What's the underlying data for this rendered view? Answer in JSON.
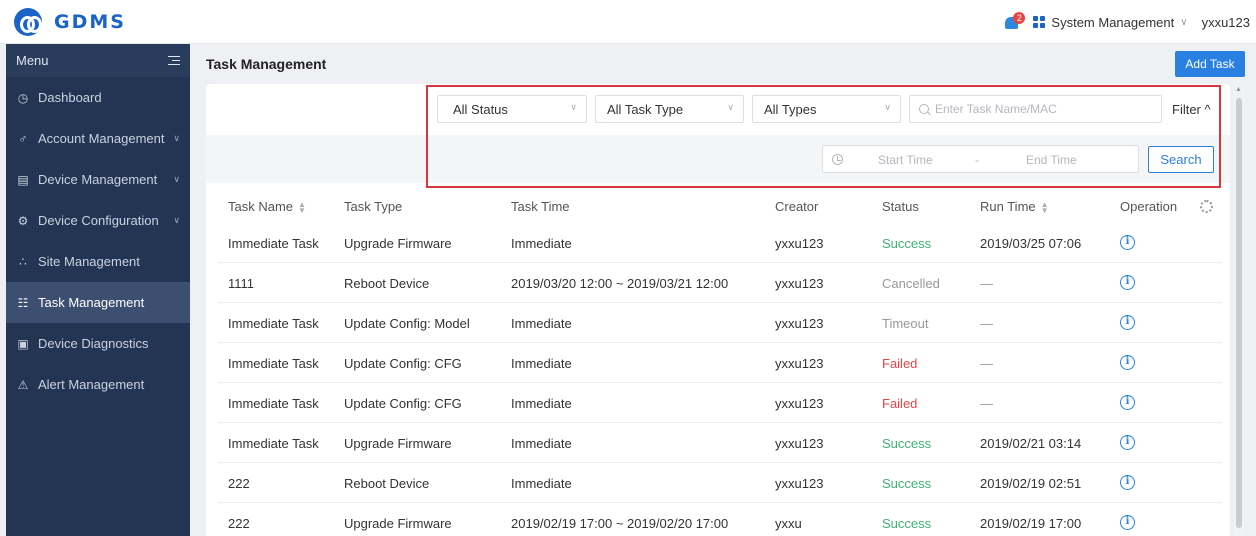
{
  "app": {
    "logo_text": "GDMS",
    "brand_color": "#1a63c7"
  },
  "header": {
    "notification_count": "2",
    "system_menu_label": "System Management",
    "username": "yxxu123"
  },
  "sidebar": {
    "menu_label": "Menu",
    "items": [
      {
        "label": "Dashboard",
        "icon": "dashboard-icon",
        "expandable": false,
        "active": false
      },
      {
        "label": "Account Management",
        "icon": "user-icon",
        "expandable": true,
        "active": false
      },
      {
        "label": "Device Management",
        "icon": "device-icon",
        "expandable": true,
        "active": false
      },
      {
        "label": "Device Configuration",
        "icon": "gear-icon",
        "expandable": true,
        "active": false
      },
      {
        "label": "Site Management",
        "icon": "site-icon",
        "expandable": false,
        "active": false
      },
      {
        "label": "Task Management",
        "icon": "task-icon",
        "expandable": false,
        "active": true
      },
      {
        "label": "Device Diagnostics",
        "icon": "diagnostics-icon",
        "expandable": false,
        "active": false
      },
      {
        "label": "Alert Management",
        "icon": "alert-icon",
        "expandable": false,
        "active": false
      }
    ]
  },
  "main": {
    "title": "Task Management",
    "add_task_label": "Add Task"
  },
  "filters": {
    "status_select": "All Status",
    "task_type_select": "All Task Type",
    "types_select": "All Types",
    "search_placeholder": "Enter Task Name/MAC",
    "filter_toggle": "Filter ^",
    "start_time_placeholder": "Start Time",
    "range_separator": "-",
    "end_time_placeholder": "End Time",
    "search_button": "Search"
  },
  "table": {
    "columns": [
      "Task Name",
      "Task Type",
      "Task Time",
      "Creator",
      "Status",
      "Run Time",
      "Operation"
    ],
    "rows": [
      {
        "name": "Immediate Task",
        "type": "Upgrade Firmware",
        "time": "Immediate",
        "creator": "yxxu123",
        "status": "Success",
        "run_time": "2019/03/25 07:06"
      },
      {
        "name": "1111",
        "type": "Reboot Device",
        "time": "2019/03/20 12:00 ~ 2019/03/21 12:00",
        "creator": "yxxu123",
        "status": "Cancelled",
        "run_time": "—"
      },
      {
        "name": "Immediate Task",
        "type": "Update Config: Model",
        "time": "Immediate",
        "creator": "yxxu123",
        "status": "Timeout",
        "run_time": "—"
      },
      {
        "name": "Immediate Task",
        "type": "Update Config: CFG",
        "time": "Immediate",
        "creator": "yxxu123",
        "status": "Failed",
        "run_time": "—"
      },
      {
        "name": "Immediate Task",
        "type": "Update Config: CFG",
        "time": "Immediate",
        "creator": "yxxu123",
        "status": "Failed",
        "run_time": "—"
      },
      {
        "name": "Immediate Task",
        "type": "Upgrade Firmware",
        "time": "Immediate",
        "creator": "yxxu123",
        "status": "Success",
        "run_time": "2019/02/21 03:14"
      },
      {
        "name": "222",
        "type": "Reboot Device",
        "time": "Immediate",
        "creator": "yxxu123",
        "status": "Success",
        "run_time": "2019/02/19 02:51"
      },
      {
        "name": "222",
        "type": "Upgrade Firmware",
        "time": "2019/02/19 17:00 ~ 2019/02/20 17:00",
        "creator": "yxxu",
        "status": "Success",
        "run_time": "2019/02/19 17:00"
      }
    ]
  },
  "status_colors": {
    "Success": "#3cb371",
    "Cancelled": "#999999",
    "Timeout": "#999999",
    "Failed": "#e94343"
  }
}
